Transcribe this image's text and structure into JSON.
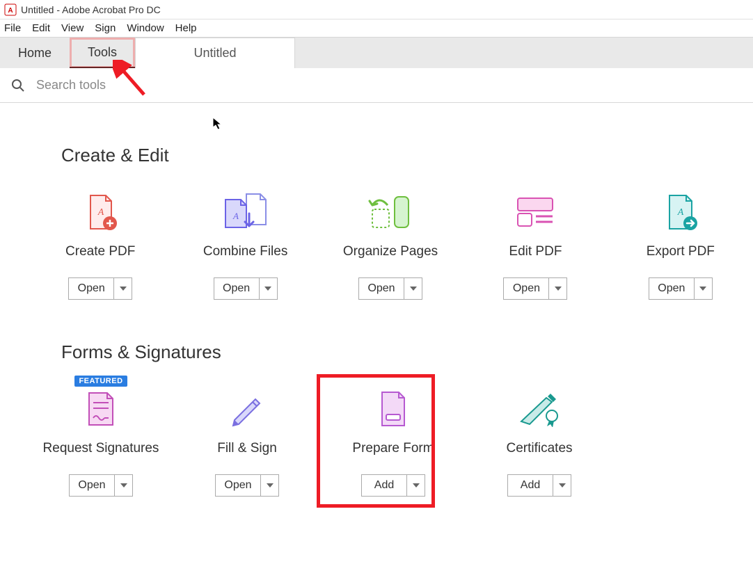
{
  "window": {
    "title": "Untitled - Adobe Acrobat Pro DC"
  },
  "menu": {
    "items": [
      "File",
      "Edit",
      "View",
      "Sign",
      "Window",
      "Help"
    ]
  },
  "tabs": {
    "home": "Home",
    "tools": "Tools",
    "doc": "Untitled"
  },
  "search": {
    "placeholder": "Search tools"
  },
  "sections": {
    "create_edit": {
      "title": "Create & Edit",
      "tools": [
        {
          "label": "Create PDF",
          "button": "Open"
        },
        {
          "label": "Combine Files",
          "button": "Open"
        },
        {
          "label": "Organize Pages",
          "button": "Open"
        },
        {
          "label": "Edit PDF",
          "button": "Open"
        },
        {
          "label": "Export PDF",
          "button": "Open"
        }
      ]
    },
    "forms_sig": {
      "title": "Forms & Signatures",
      "tools": [
        {
          "label": "Request Signatures",
          "button": "Open",
          "badge": "FEATURED"
        },
        {
          "label": "Fill & Sign",
          "button": "Open"
        },
        {
          "label": "Prepare Form",
          "button": "Add"
        },
        {
          "label": "Certificates",
          "button": "Add"
        }
      ]
    }
  }
}
